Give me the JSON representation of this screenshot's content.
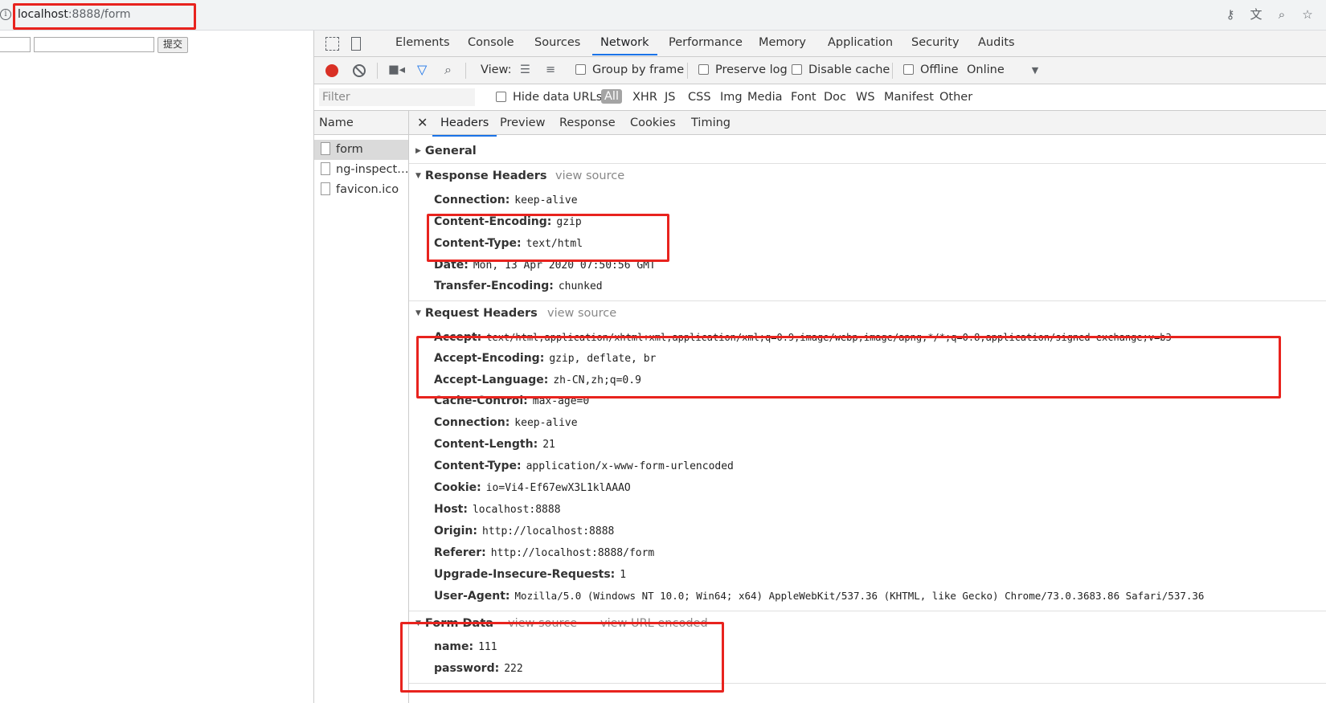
{
  "address": {
    "host": "localhost",
    "path": ":8888/form",
    "info_icon": "info-icon",
    "icons": [
      "key-icon",
      "translate-icon",
      "zoom-icon",
      "star-icon"
    ]
  },
  "page": {
    "submit_label": "提交"
  },
  "devtools": {
    "tabs": [
      "Elements",
      "Console",
      "Sources",
      "Network",
      "Performance",
      "Memory",
      "Application",
      "Security",
      "Audits"
    ],
    "active_tab": "Network",
    "toolbar": {
      "view_label": "View:",
      "group_by_frame": "Group by frame",
      "preserve_log": "Preserve log",
      "disable_cache": "Disable cache",
      "offline": "Offline",
      "online": "Online"
    },
    "filter": {
      "placeholder": "Filter",
      "hide_data_urls": "Hide data URLs",
      "types": [
        "All",
        "XHR",
        "JS",
        "CSS",
        "Img",
        "Media",
        "Font",
        "Doc",
        "WS",
        "Manifest",
        "Other"
      ]
    },
    "name_header": "Name",
    "requests": [
      "form",
      "ng-inspect…",
      "favicon.ico"
    ],
    "detail_tabs": [
      "Headers",
      "Preview",
      "Response",
      "Cookies",
      "Timing"
    ],
    "general_label": "General",
    "view_source": "view source",
    "view_url_encoded": "view URL encoded",
    "response_headers": {
      "title": "Response Headers",
      "rows": [
        {
          "k": "Connection:",
          "v": "keep-alive"
        },
        {
          "k": "Content-Encoding:",
          "v": "gzip"
        },
        {
          "k": "Content-Type:",
          "v": "text/html"
        },
        {
          "k": "Date:",
          "v": "Mon, 13 Apr 2020 07:50:56 GMT"
        },
        {
          "k": "Transfer-Encoding:",
          "v": "chunked"
        }
      ]
    },
    "request_headers": {
      "title": "Request Headers",
      "rows": [
        {
          "k": "Accept:",
          "v": "text/html,application/xhtml+xml,application/xml;q=0.9,image/webp,image/apng,*/*;q=0.8,application/signed-exchange;v=b3"
        },
        {
          "k": "Accept-Encoding:",
          "v": "gzip, deflate, br"
        },
        {
          "k": "Accept-Language:",
          "v": "zh-CN,zh;q=0.9"
        },
        {
          "k": "Cache-Control:",
          "v": "max-age=0"
        },
        {
          "k": "Connection:",
          "v": "keep-alive"
        },
        {
          "k": "Content-Length:",
          "v": "21"
        },
        {
          "k": "Content-Type:",
          "v": "application/x-www-form-urlencoded"
        },
        {
          "k": "Cookie:",
          "v": "io=Vi4-Ef67ewX3L1klAAAO"
        },
        {
          "k": "Host:",
          "v": "localhost:8888"
        },
        {
          "k": "Origin:",
          "v": "http://localhost:8888"
        },
        {
          "k": "Referer:",
          "v": "http://localhost:8888/form"
        },
        {
          "k": "Upgrade-Insecure-Requests:",
          "v": "1"
        },
        {
          "k": "User-Agent:",
          "v": "Mozilla/5.0 (Windows NT 10.0; Win64; x64) AppleWebKit/537.36 (KHTML, like Gecko) Chrome/73.0.3683.86 Safari/537.36"
        }
      ]
    },
    "form_data": {
      "title": "Form Data",
      "rows": [
        {
          "k": "name:",
          "v": "111"
        },
        {
          "k": "password:",
          "v": "222"
        }
      ]
    }
  },
  "colors": {
    "highlight": "#e8231e",
    "accent": "#1a73e8",
    "record": "#d93025"
  }
}
